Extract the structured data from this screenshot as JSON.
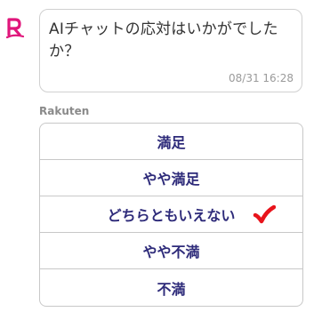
{
  "message": {
    "text": "AIチャットの応対はいかがでしたか？",
    "timestamp": "08/31 16:28"
  },
  "sender": {
    "name": "Rakuten"
  },
  "survey": {
    "options": [
      {
        "label": "満足"
      },
      {
        "label": "やや満足"
      },
      {
        "label": "どちらともいえない",
        "selected": true
      },
      {
        "label": "やや不満"
      },
      {
        "label": "不満"
      }
    ]
  },
  "icons": {
    "avatar": "rakuten-r-logo-icon",
    "selection": "red-checkmark-icon"
  },
  "colors": {
    "brand": "#e0167b",
    "option_text": "#2e2b7a",
    "check": "#e8141c"
  }
}
